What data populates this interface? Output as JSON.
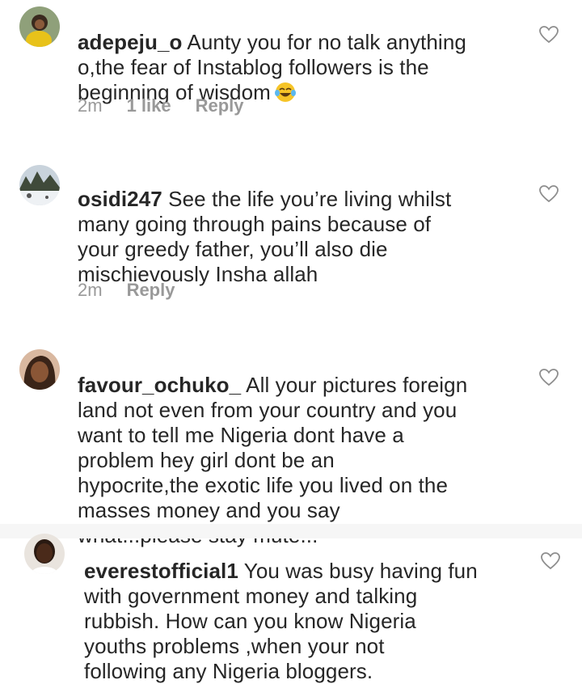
{
  "comments": [
    {
      "username": "adepeju_o",
      "text": " Aunty you for no talk anything\no,the fear of Instablog followers is the\nbeginning of wisdom",
      "emoji": "face-with-tears-of-joy",
      "time": "2m",
      "likes": "1 like",
      "reply": "Reply"
    },
    {
      "username": "osidi247",
      "text": " See the life you’re living whilst\nmany going through pains because of\nyour greedy father, you’ll also die\nmischievously Insha allah",
      "time": "2m",
      "reply": "Reply"
    },
    {
      "username": "favour_ochuko_",
      "text": " All your pictures foreign\nland not even from your country and you\nwant to tell me Nigeria dont have a\nproblem hey girl dont be an\nhypocrite,the exotic life you lived on the\nmasses money and you say\nwhat...please stay mute..."
    },
    {
      "username": "everestofficial1",
      "text": " You was busy having fun\nwith government money and talking\nrubbish. How can you know Nigeria\nyouths problems ,when your not\nfollowing any Nigeria bloggers."
    }
  ],
  "icons": {
    "like": "heart-outline-icon",
    "emoji": "face-with-tears-of-joy-icon"
  },
  "colors": {
    "text": "#262626",
    "meta": "#999999",
    "heart": "#8e8e8e"
  }
}
